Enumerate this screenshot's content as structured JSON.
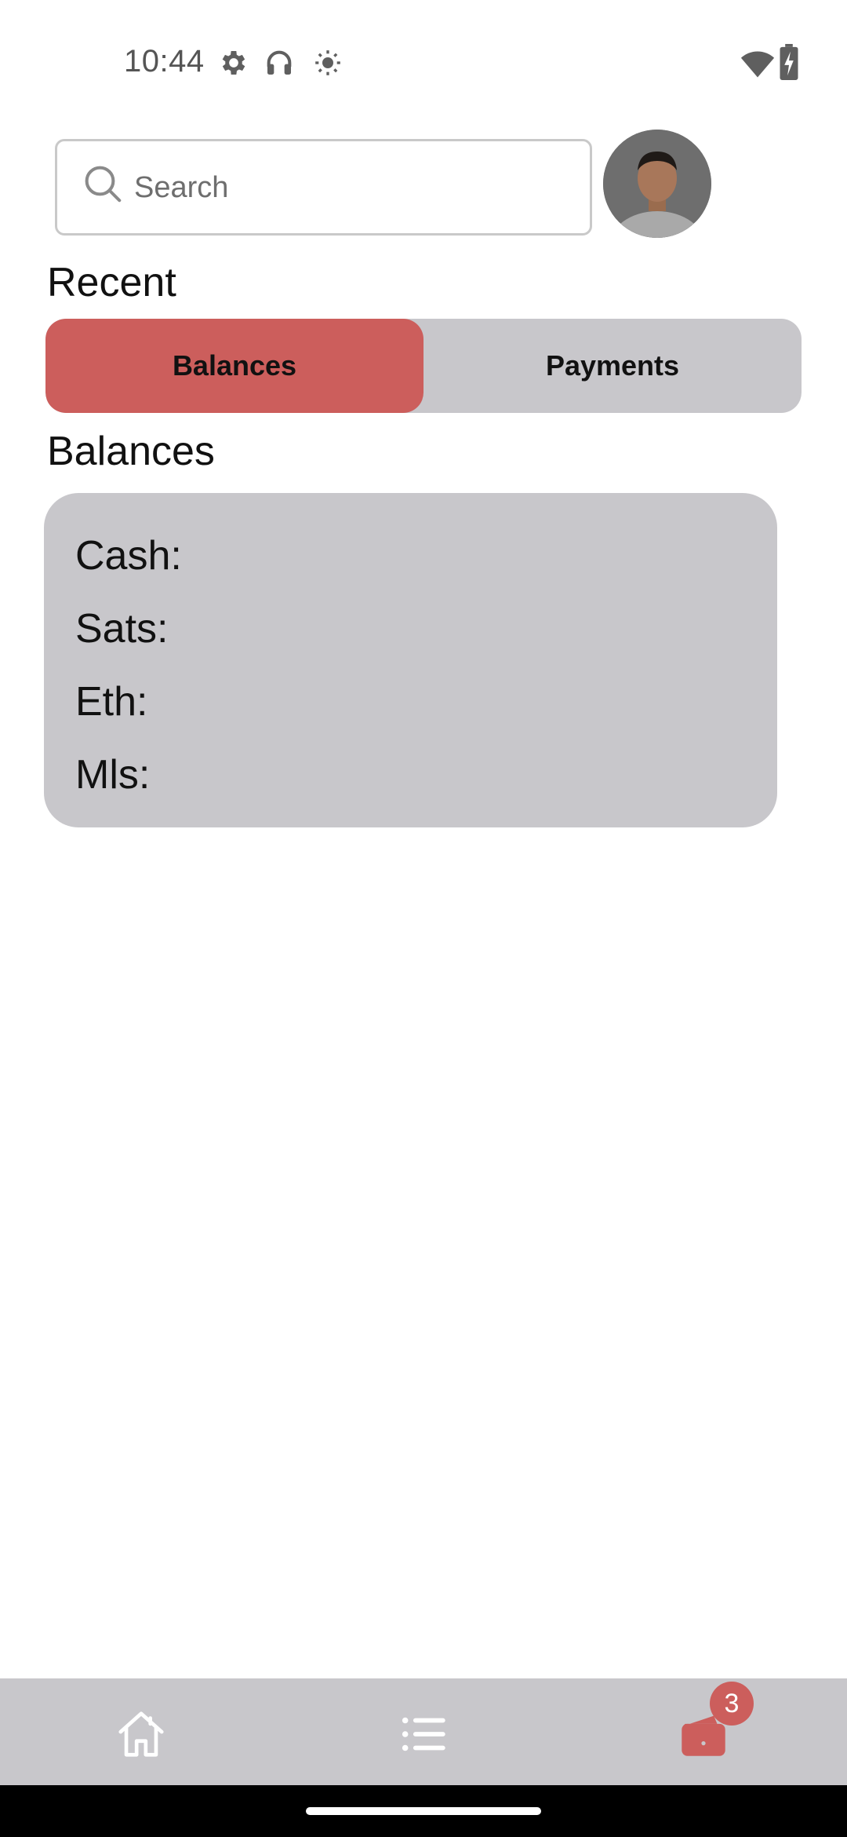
{
  "status_bar": {
    "time": "10:44",
    "icons": [
      "gear-icon",
      "headphones-icon",
      "brightness-icon",
      "wifi-icon",
      "battery-charging-icon"
    ]
  },
  "search": {
    "placeholder": "Search",
    "icon": "search-icon"
  },
  "profile": {
    "avatar": "user-avatar"
  },
  "recent": {
    "title": "Recent",
    "tabs": [
      {
        "label": "Balances",
        "active": true
      },
      {
        "label": "Payments",
        "active": false
      }
    ]
  },
  "balances": {
    "title": "Balances",
    "lines": [
      {
        "label": "Cash:"
      },
      {
        "label": "Sats:"
      },
      {
        "label": "Eth:"
      },
      {
        "label": "Mls:"
      }
    ]
  },
  "bottom_nav": {
    "items": [
      {
        "icon": "home-icon"
      },
      {
        "icon": "list-icon"
      },
      {
        "icon": "wallet-icon",
        "badge": "3"
      }
    ]
  },
  "colors": {
    "accent": "#cc5e5c",
    "surface": "#c8c7cb",
    "background": "#ffffff"
  }
}
